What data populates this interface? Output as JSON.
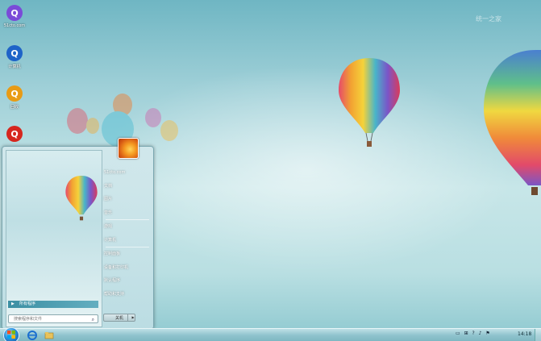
{
  "desktop": {
    "watermark": "统一之家",
    "icons": [
      {
        "label": "51cto.com",
        "color": "#7a4bd8",
        "glyph": "Q"
      },
      {
        "label": "计算机",
        "color": "#1e63c8",
        "glyph": "Q"
      },
      {
        "label": "回收",
        "color": "#e89b15",
        "glyph": "Q"
      },
      {
        "label": "",
        "color": "#d6261e",
        "glyph": "Q"
      }
    ]
  },
  "start_menu": {
    "all_programs": "所有程序",
    "search_placeholder": "搜索程序和文件",
    "search_icon": "magnifier-icon",
    "right_items": [
      {
        "label": "51cto.com"
      },
      {
        "label": "文档"
      },
      {
        "label": "图片"
      },
      {
        "label": "音乐"
      },
      {
        "label": "游戏"
      },
      {
        "label": "计算机"
      },
      {
        "label": "控制面板"
      },
      {
        "label": "设备和打印机"
      },
      {
        "label": "默认程序"
      },
      {
        "label": "帮助和支持"
      }
    ],
    "shutdown_label": "关机",
    "shutdown_arrow": "▶"
  },
  "taskbar": {
    "clock": "14:18",
    "tray_glyphs": [
      "▭",
      "⊞",
      "?",
      "♪",
      "⚑"
    ]
  },
  "colors": {
    "accent": "#3b8fa3"
  }
}
